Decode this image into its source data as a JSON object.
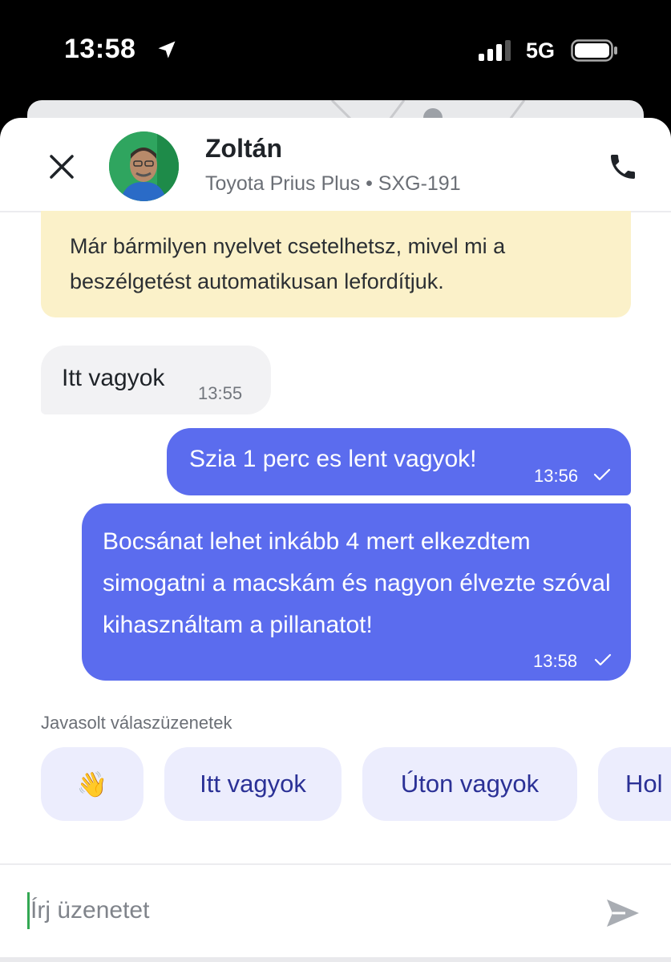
{
  "status_bar": {
    "time": "13:58",
    "network": "5G",
    "location_icon": "location-arrow-icon",
    "signal_icon": "cellular-signal-icon",
    "battery_icon": "battery-icon"
  },
  "header": {
    "close_icon": "close-icon",
    "driver_name": "Zoltán",
    "car_info": "Toyota Prius Plus • SXG-191",
    "call_icon": "phone-icon"
  },
  "notice": {
    "text": "Már bármilyen nyelvet csetelhetsz, mivel mi a beszélgetést automatikusan lefordítjuk."
  },
  "messages": [
    {
      "direction": "incoming",
      "text": "Itt vagyok",
      "time": "13:55"
    },
    {
      "direction": "outgoing",
      "text": "Szia 1 perc es lent vagyok!",
      "time": "13:56",
      "status_icon": "sent-check-icon"
    },
    {
      "direction": "outgoing",
      "text": "Bocsánat lehet inkább 4 mert elkezdtem simogatni a macskám és nagyon élvezte szóval kihasználtam a pillanatot!",
      "time": "13:58",
      "status_icon": "sent-check-icon"
    }
  ],
  "suggestions": {
    "title": "Javasolt válaszüzenetek",
    "items": [
      "👋",
      "Itt vagyok",
      "Úton vagyok",
      "Hol"
    ]
  },
  "composer": {
    "placeholder": "Írj üzenetet",
    "send_icon": "send-icon"
  },
  "colors": {
    "outgoing_bubble": "#5b6cee",
    "incoming_bubble": "#f2f2f4",
    "notice_bg": "#fbf1c9",
    "chip_bg": "#ecedfd",
    "chip_text": "#2b3196"
  }
}
